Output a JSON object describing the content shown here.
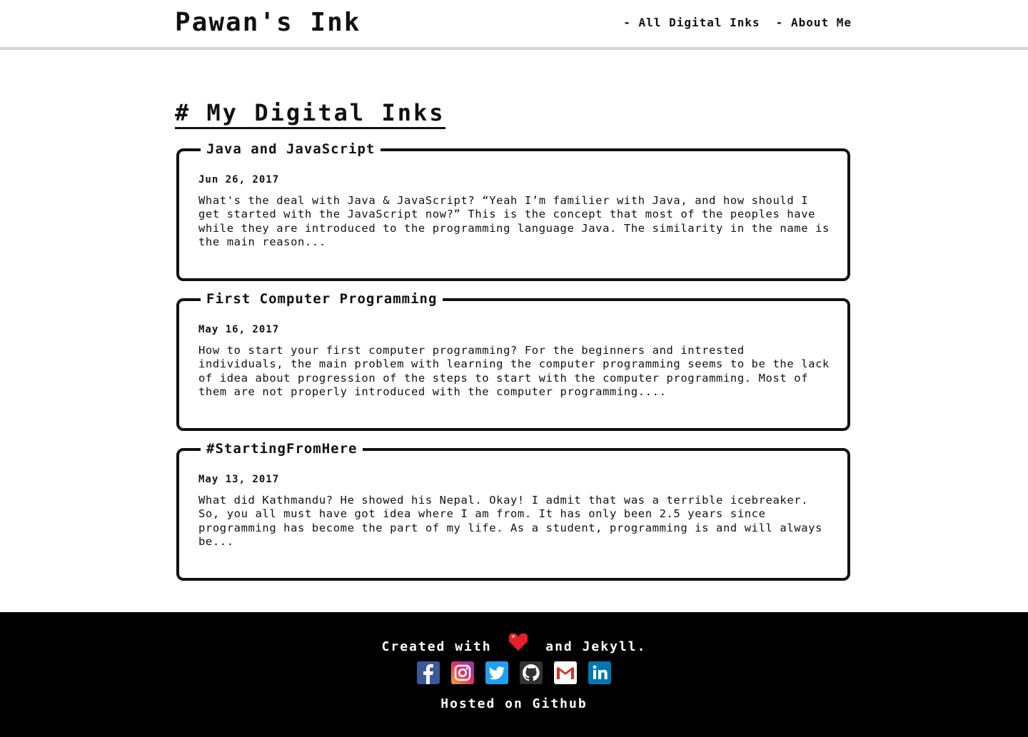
{
  "header": {
    "site_title": "Pawan's Ink",
    "nav": [
      {
        "label": "- All Digital Inks"
      },
      {
        "label": "- About Me"
      }
    ]
  },
  "main": {
    "heading": "# My Digital Inks",
    "posts": [
      {
        "title": "Java and JavaScript",
        "date": "Jun 26, 2017",
        "excerpt": "What's the deal with Java & JavaScript? “Yeah I’m familier with Java, and how should I get started with the JavaScript now?” This is the concept that most of the peoples have while they are introduced to the programming language Java. The similarity in the name is the main reason..."
      },
      {
        "title": "First Computer Programming",
        "date": "May 16, 2017",
        "excerpt": "How to start your first computer programming? For the beginners and intrested individuals, the main problem with learning the computer programming seems to be the lack of idea about progression of the steps to start with the computer programming. Most of them are not properly introduced with the computer programming...."
      },
      {
        "title": "#StartingFromHere",
        "date": "May 13, 2017",
        "excerpt": "What did Kathmandu? He showed his Nepal. Okay! I admit that was a terrible icebreaker. So, you all must have got idea where I am from. It has only been 2.5 years since programming has become the part of my life. As a student, programming is and will always be..."
      }
    ]
  },
  "footer": {
    "credit_before": "Created with",
    "credit_after": "and Jekyll.",
    "heart_icon": "heart-icon",
    "heart_color": "#e8202b",
    "socials": [
      {
        "icon": "facebook-icon",
        "color": "#3b5998"
      },
      {
        "icon": "instagram-icon",
        "color": "#c13584"
      },
      {
        "icon": "twitter-icon",
        "color": "#1da1f2"
      },
      {
        "icon": "github-icon",
        "color": "#333333"
      },
      {
        "icon": "gmail-icon",
        "color": "#ffffff"
      },
      {
        "icon": "linkedin-icon",
        "color": "#0077b5"
      }
    ],
    "hosted": "Hosted on Github"
  }
}
